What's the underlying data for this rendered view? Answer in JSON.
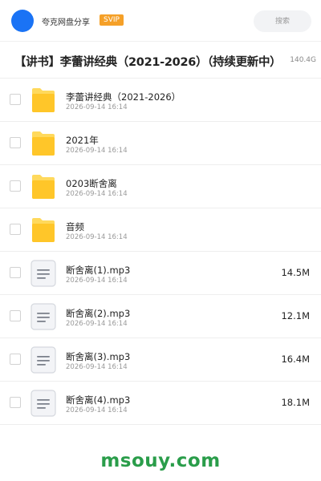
{
  "header": {
    "username": "夸克网盘分享",
    "badge": "SVIP",
    "search_placeholder": "搜索"
  },
  "folder": {
    "title": "【讲书】李蕾讲经典（2021-2026）（持续更新中）",
    "total_size": "140.4G"
  },
  "items": [
    {
      "type": "folder",
      "icon": "folder-icon",
      "name": "李蕾讲经典（2021-2026）",
      "date": "2026-09-14 16:14",
      "size": ""
    },
    {
      "type": "folder",
      "icon": "folder-icon",
      "name": "2021年",
      "date": "2026-09-14 16:14",
      "size": ""
    },
    {
      "type": "folder",
      "icon": "folder-icon",
      "name": "0203断舍离",
      "date": "2026-09-14 16:14",
      "size": ""
    },
    {
      "type": "folder",
      "icon": "folder-icon",
      "name": "音频",
      "date": "2026-09-14 16:14",
      "size": ""
    },
    {
      "type": "file",
      "icon": "file-icon",
      "name": "断舍离(1).mp3",
      "date": "2026-09-14 16:14",
      "size": "14.5M"
    },
    {
      "type": "file",
      "icon": "file-icon",
      "name": "断舍离(2).mp3",
      "date": "2026-09-14 16:14",
      "size": "12.1M"
    },
    {
      "type": "file",
      "icon": "file-icon",
      "name": "断舍离(3).mp3",
      "date": "2026-09-14 16:14",
      "size": "16.4M"
    },
    {
      "type": "file",
      "icon": "file-icon",
      "name": "断舍离(4).mp3",
      "date": "2026-09-14 16:14",
      "size": "18.1M"
    }
  ],
  "watermark": "msouy.com",
  "colors": {
    "avatar": "#1a73f5",
    "badge": "#f5a028",
    "folder": "#ffc629",
    "watermark": "#2a9d4a"
  }
}
